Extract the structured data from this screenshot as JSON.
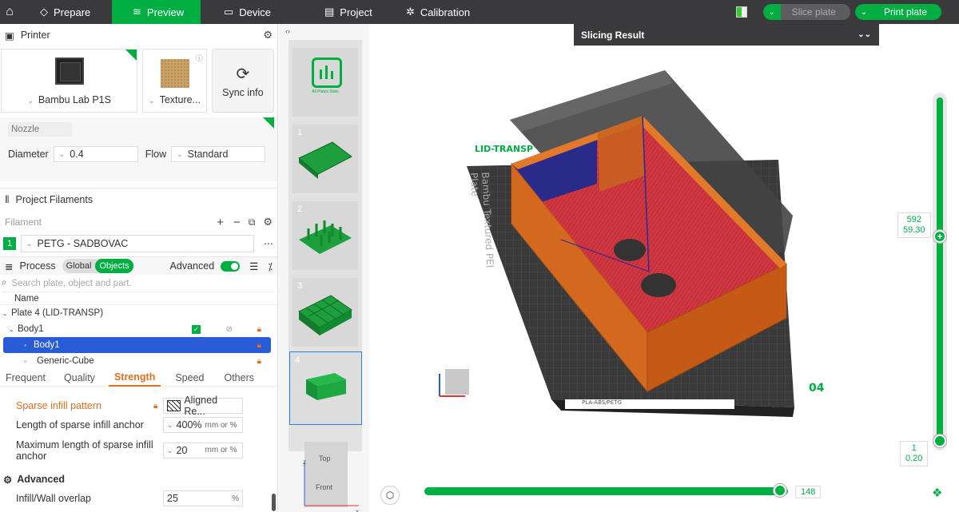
{
  "topbar": {
    "tabs": [
      {
        "label": "Prepare",
        "active": false
      },
      {
        "label": "Preview",
        "active": true
      },
      {
        "label": "Device",
        "active": false
      },
      {
        "label": "Project",
        "active": false
      },
      {
        "label": "Calibration",
        "active": false
      }
    ],
    "slice_plate": "Slice plate",
    "print_plate": "Print plate"
  },
  "printer": {
    "section_title": "Printer",
    "printer_name": "Bambu Lab P1S",
    "plate_type": "Texture...",
    "sync_info": "Sync info",
    "nozzle_label": "Nozzle",
    "diameter_label": "Diameter",
    "diameter_value": "0.4",
    "flow_label": "Flow",
    "flow_value": "Standard"
  },
  "filaments": {
    "section_title": "Project Filaments",
    "filament_label": "Filament",
    "items": [
      {
        "index": "1",
        "name": "PETG - SADBOVAC"
      }
    ]
  },
  "process": {
    "title": "Process",
    "global": "Global",
    "objects": "Objects",
    "advanced": "Advanced",
    "search_placeholder": "Search plate, object and part.",
    "tree_header": "Name",
    "tree": [
      {
        "label": "Plate 4 (LID-TRANSP)"
      },
      {
        "label": "Body1"
      },
      {
        "label": "Body1"
      },
      {
        "label": "Generic-Cube"
      }
    ],
    "subtabs": [
      "Frequent",
      "Quality",
      "Strength",
      "Speed",
      "Others"
    ],
    "active_subtab": "Strength",
    "params": [
      {
        "label": "Sparse infill pattern",
        "value": "Aligned Re...",
        "unit": ""
      },
      {
        "label": "Length of sparse infill anchor",
        "value": "400%",
        "unit": "mm or %"
      },
      {
        "label": "Maximum length of sparse infill anchor",
        "value": "20",
        "unit": "mm or %"
      }
    ],
    "advanced_section": "Advanced",
    "overlap_label": "Infill/Wall overlap",
    "overlap_value": "25",
    "overlap_unit": "%"
  },
  "thumbnails": {
    "all_plates_label": "All Plates Stats",
    "plates": [
      "1",
      "2",
      "3",
      "4"
    ],
    "selected": "4",
    "viewcube_top": "Top",
    "viewcube_front": "Front"
  },
  "viewport": {
    "slicing_result": "Slicing Result",
    "object_label": "LID-TRANSP",
    "bed_label": "Bambu Textured PEI Plate",
    "bed_material": "PLA-ABS/PETG",
    "plate_number": "04",
    "layer_top": "592",
    "height_top": "59.30",
    "layer_bottom": "1",
    "height_bottom": "0.20",
    "move_value": "148",
    "move_fraction": 0.98
  },
  "colors": {
    "accent": "#00ae42",
    "toolbar": "#3a3a3c",
    "model_wall": "#d2691e",
    "model_infill": "#d0363a"
  }
}
